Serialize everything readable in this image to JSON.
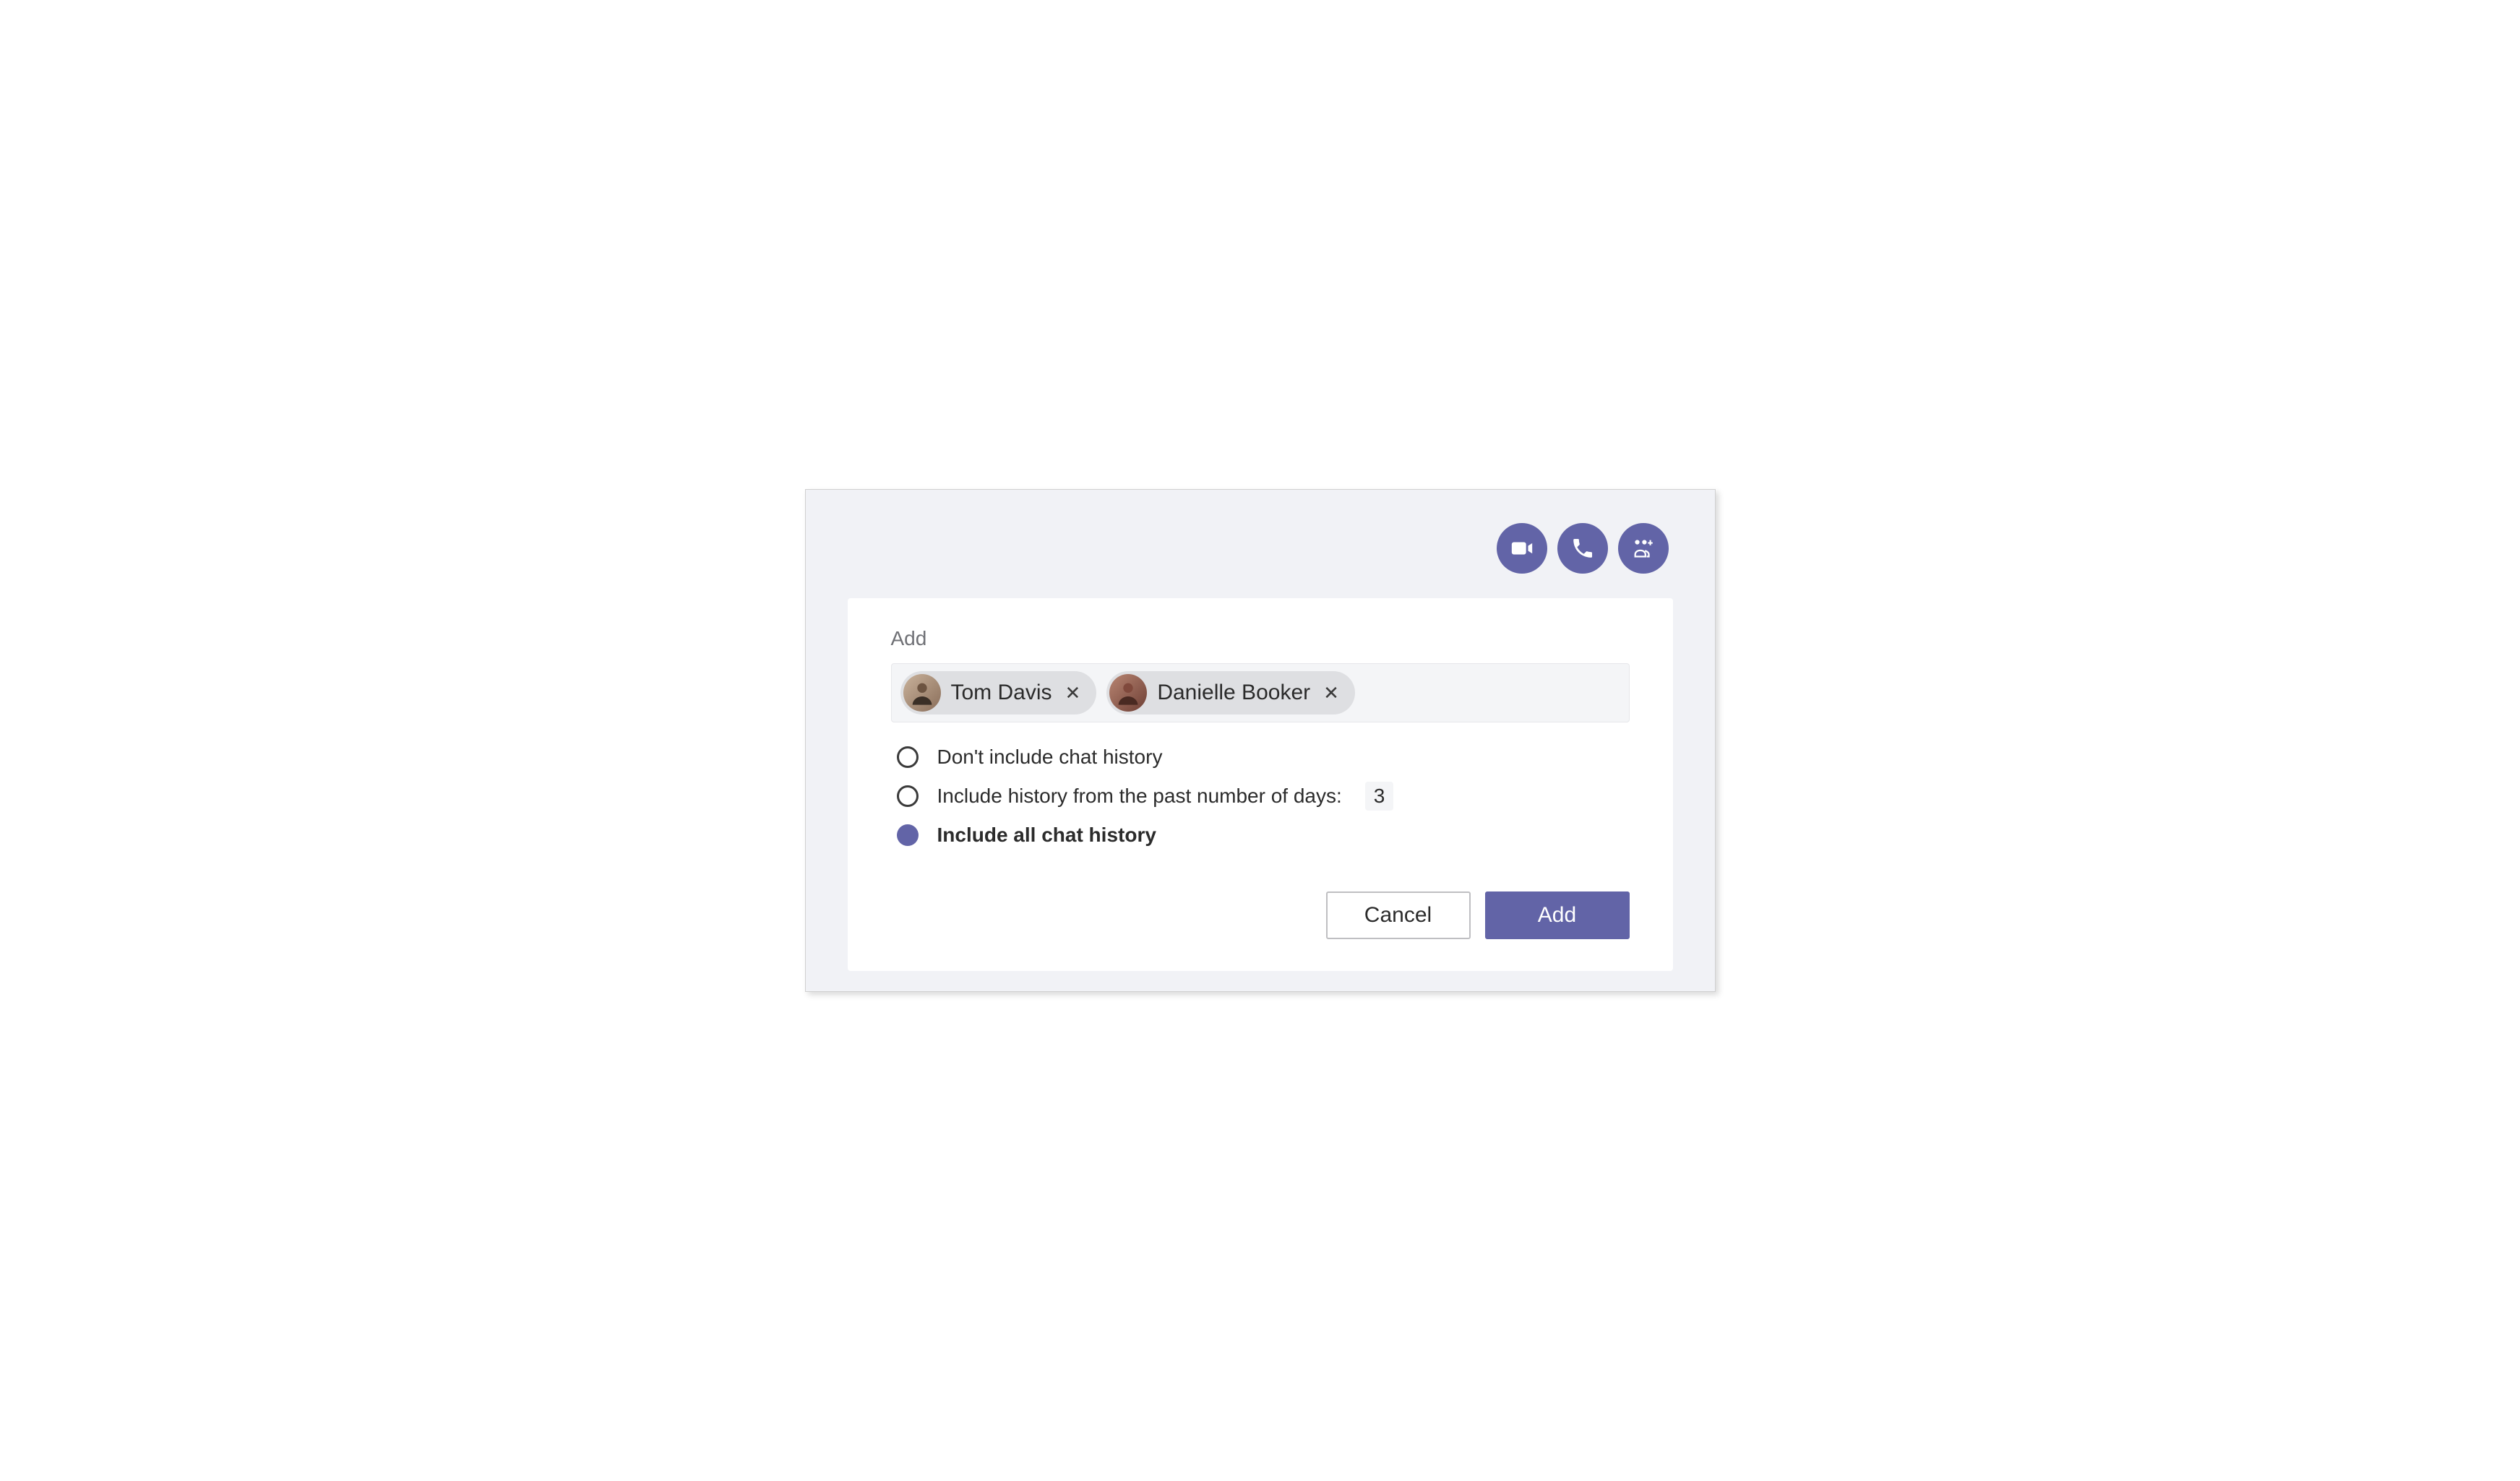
{
  "toolbar": {
    "video_icon": "video-camera-icon",
    "call_icon": "phone-icon",
    "add_people_icon": "people-add-icon"
  },
  "panel": {
    "title": "Add",
    "participants": [
      {
        "name": "Tom Davis"
      },
      {
        "name": "Danielle Booker"
      }
    ],
    "options": {
      "none": "Don't include chat history",
      "days": "Include history from the past number of days:",
      "days_value": "3",
      "all": "Include all chat history",
      "selected_index": 2
    },
    "buttons": {
      "cancel": "Cancel",
      "add": "Add"
    }
  }
}
